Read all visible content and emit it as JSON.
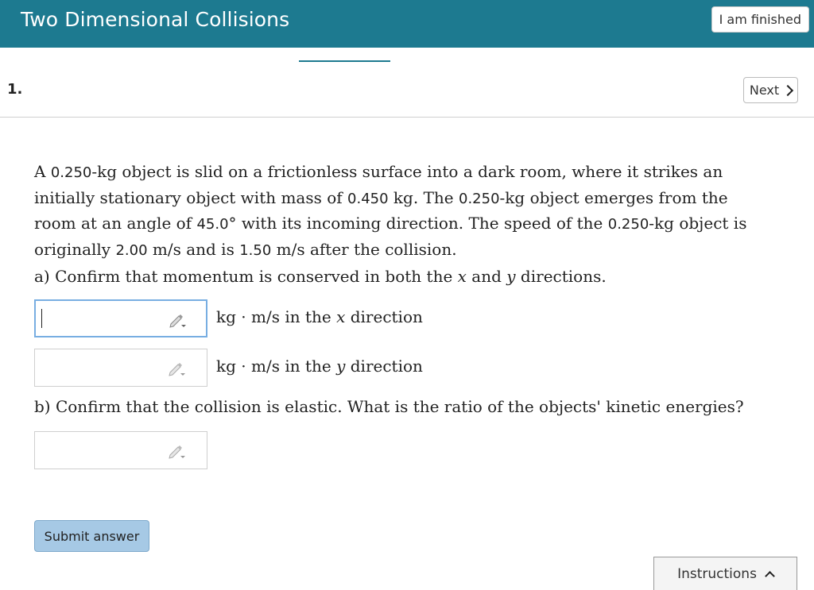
{
  "header": {
    "title": "Two Dimensional Collisions",
    "finished_label": "I am finished"
  },
  "question": {
    "number": "1.",
    "next_label": "Next",
    "problem": {
      "t1": "A ",
      "m1": "0.250",
      "t2": "-kg object is slid on a frictionless surface into a dark room, where it strikes an initially stationary object with mass of ",
      "m2": "0.450",
      "t3": " kg. The ",
      "m3": "0.250",
      "t4": "-kg object emerges from the room at an angle of ",
      "m4": "45.0",
      "t5": "° with its incoming direction. The speed of the ",
      "m5": "0.250",
      "t6": "-kg object is originally ",
      "m6": "2.00",
      "t7": " m/s and is ",
      "m7": "1.50",
      "t8": " m/s after the collision."
    },
    "part_a": {
      "prefix": "a) Confirm that momentum is conserved in both the ",
      "var_x": "x",
      "mid": " and ",
      "var_y": "y",
      "suffix": " directions."
    },
    "answers": [
      {
        "unit_text": "kg · m/s in the ",
        "var": "x",
        "suffix": " direction",
        "value": ""
      },
      {
        "unit_text": "kg · m/s in the ",
        "var": "y",
        "suffix": " direction",
        "value": ""
      }
    ],
    "part_b": "b) Confirm that the collision is elastic. What is the ratio of the objects' kinetic energies?",
    "answer_b": {
      "value": ""
    }
  },
  "footer": {
    "submit_label": "Submit answer",
    "instructions_label": "Instructions"
  },
  "icons": {
    "pencil": "pencil-icon",
    "chevron_next": "chevron-right-icon",
    "chevron_up": "chevron-up-icon"
  },
  "colors": {
    "header_bg": "#1d7a90",
    "submit_bg": "#a6c9e5",
    "active_border": "#78aee2"
  }
}
